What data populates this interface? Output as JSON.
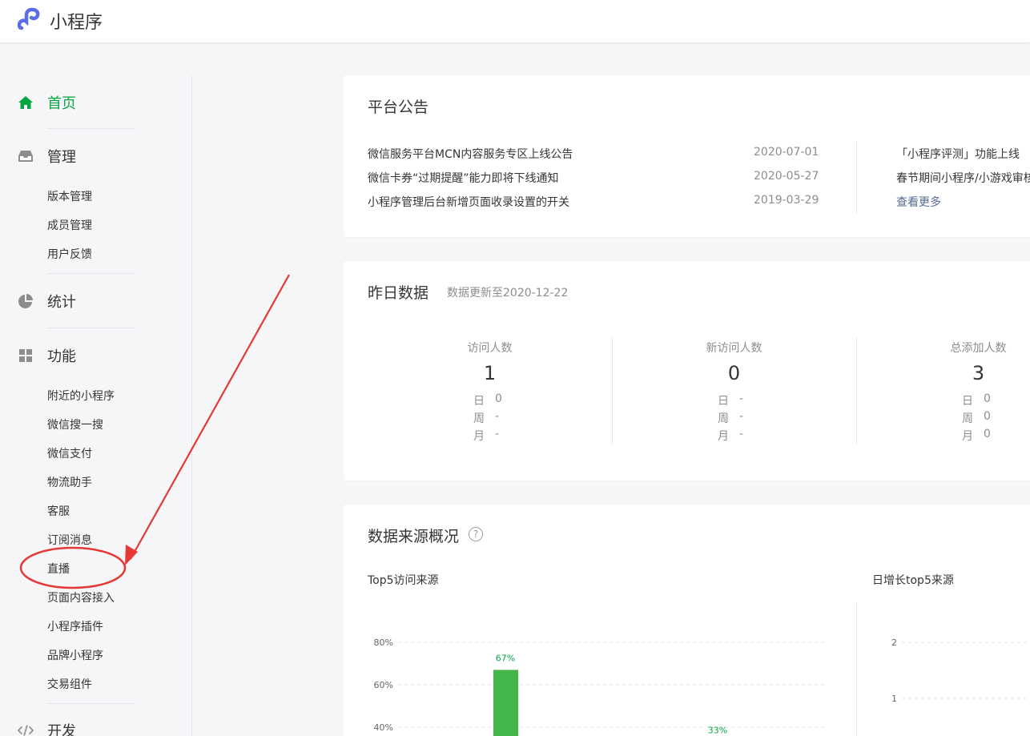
{
  "app": {
    "title": "小程序"
  },
  "sidebar": {
    "home": {
      "label": "首页",
      "icon": "home-icon"
    },
    "manage": {
      "label": "管理",
      "icon": "inbox-icon",
      "items": [
        "版本管理",
        "成员管理",
        "用户反馈"
      ]
    },
    "stats": {
      "label": "统计",
      "icon": "pie-chart-icon"
    },
    "features": {
      "label": "功能",
      "icon": "grid-icon",
      "items": [
        "附近的小程序",
        "微信搜一搜",
        "微信支付",
        "物流助手",
        "客服",
        "订阅消息",
        "直播",
        "页面内容接入",
        "小程序插件",
        "品牌小程序",
        "交易组件"
      ]
    },
    "dev": {
      "label": "开发",
      "icon": "code-icon"
    }
  },
  "announcements": {
    "title": "平台公告",
    "items": [
      {
        "text": "微信服务平台MCN内容服务专区上线公告",
        "date": "2020-07-01"
      },
      {
        "text": "微信卡券“过期提醒”能力即将下线通知",
        "date": "2020-05-27"
      },
      {
        "text": "小程序管理后台新增页面收录设置的开关",
        "date": "2019-03-29"
      }
    ],
    "side_items": [
      "「小程序评测」功能上线",
      "春节期间小程序/小游戏审核"
    ],
    "more_label": "查看更多"
  },
  "yesterday": {
    "title": "昨日数据",
    "updated": "数据更新至2020-12-22",
    "row_labels": {
      "day": "日",
      "week": "周",
      "month": "月"
    },
    "stats": [
      {
        "label": "访问人数",
        "value": "1",
        "day": "0",
        "week": "-",
        "month": "-"
      },
      {
        "label": "新访问人数",
        "value": "0",
        "day": "-",
        "week": "-",
        "month": "-"
      },
      {
        "label": "总添加人数",
        "value": "3",
        "day": "0",
        "week": "0",
        "month": "0"
      }
    ]
  },
  "sources": {
    "title": "数据来源概况",
    "help_glyph": "?",
    "left_title": "Top5访问来源",
    "right_title": "日增长top5来源"
  },
  "chart_data": [
    {
      "type": "bar",
      "title": "Top5访问来源",
      "y_ticks": [
        "80%",
        "60%",
        "40%"
      ],
      "ylim": [
        0,
        80
      ],
      "bars": [
        {
          "value": 67,
          "label": "67%"
        },
        {
          "value": 33,
          "label": "33%"
        }
      ],
      "grid": true,
      "color": "#44b549"
    },
    {
      "type": "bar",
      "title": "日增长top5来源",
      "y_ticks": [
        "2",
        "1"
      ],
      "grid": true
    }
  ],
  "annotation": {
    "color": "#e53935",
    "target": "直播"
  }
}
